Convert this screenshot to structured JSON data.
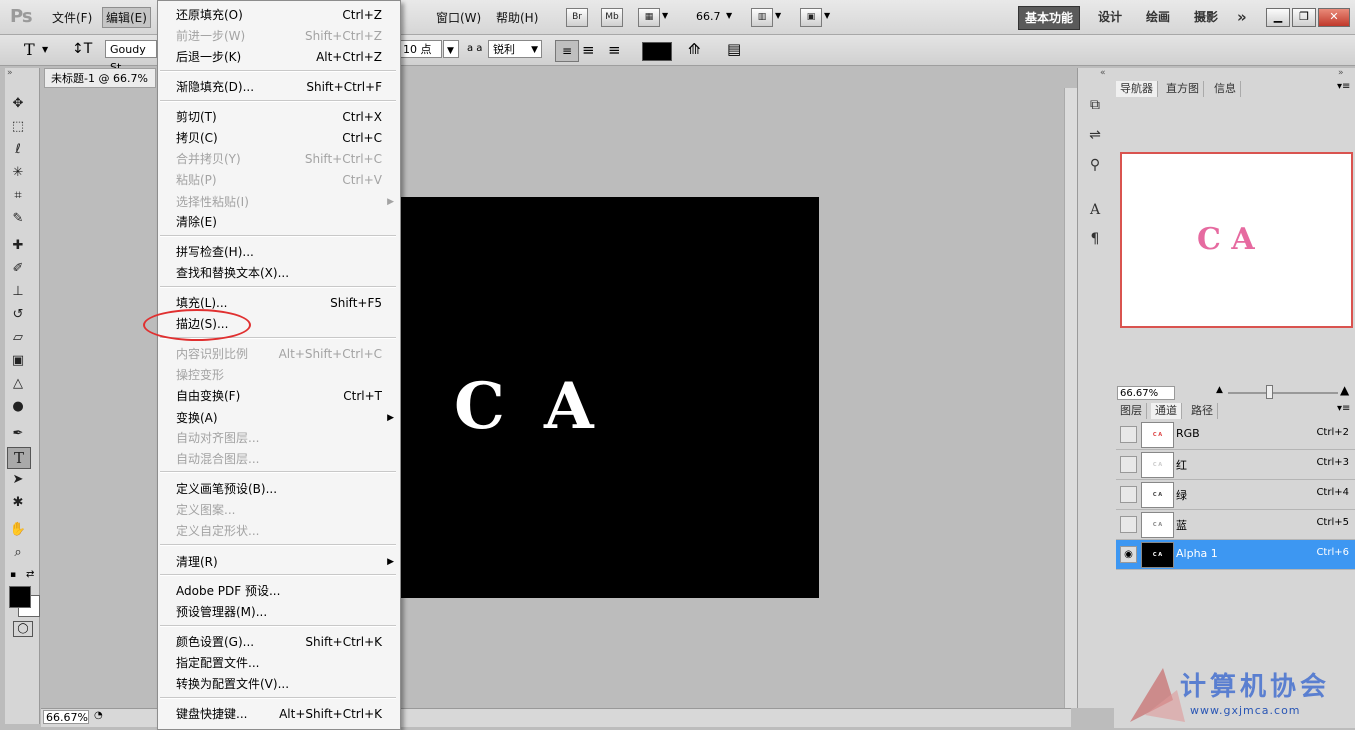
{
  "app": {
    "logo": "Ps"
  },
  "menubar": {
    "items": [
      "文件(F)",
      "编辑(E)",
      "窗口(W)",
      "帮助(H)"
    ],
    "br": "Br",
    "mb": "Mb",
    "zoom": "66.7",
    "workspaces": [
      "基本功能",
      "设计",
      "绘画",
      "摄影"
    ],
    "more": "»"
  },
  "options": {
    "tool_glyph": "T",
    "font_name": "Goudy St",
    "size": "10 点",
    "aa_label": "a a",
    "antialias": "锐利",
    "text_color": "#000000"
  },
  "document": {
    "tab_title": "未标题-1 @ 66.7%",
    "canvas_text": [
      "C",
      "A"
    ],
    "zoom": "66.67%"
  },
  "menu": {
    "items": [
      {
        "label": "还原填充(O)",
        "shortcut": "Ctrl+Z",
        "disabled": false
      },
      {
        "label": "前进一步(W)",
        "shortcut": "Shift+Ctrl+Z",
        "disabled": true
      },
      {
        "label": "后退一步(K)",
        "shortcut": "Alt+Ctrl+Z",
        "disabled": false
      },
      {
        "label": "渐隐填充(D)...",
        "shortcut": "Shift+Ctrl+F",
        "disabled": false
      },
      {
        "label": "剪切(T)",
        "shortcut": "Ctrl+X",
        "disabled": false
      },
      {
        "label": "拷贝(C)",
        "shortcut": "Ctrl+C",
        "disabled": false
      },
      {
        "label": "合并拷贝(Y)",
        "shortcut": "Shift+Ctrl+C",
        "disabled": true
      },
      {
        "label": "粘贴(P)",
        "shortcut": "Ctrl+V",
        "disabled": true
      },
      {
        "label": "选择性粘贴(I)",
        "shortcut": "",
        "disabled": true,
        "submenu": true
      },
      {
        "label": "清除(E)",
        "shortcut": "",
        "disabled": false
      },
      {
        "label": "拼写检查(H)...",
        "shortcut": "",
        "disabled": false
      },
      {
        "label": "查找和替换文本(X)...",
        "shortcut": "",
        "disabled": false
      },
      {
        "label": "填充(L)...",
        "shortcut": "Shift+F5",
        "disabled": false
      },
      {
        "label": "描边(S)...",
        "shortcut": "",
        "disabled": false
      },
      {
        "label": "内容识别比例",
        "shortcut": "Alt+Shift+Ctrl+C",
        "disabled": true
      },
      {
        "label": "操控变形",
        "shortcut": "",
        "disabled": true
      },
      {
        "label": "自由变换(F)",
        "shortcut": "Ctrl+T",
        "disabled": false
      },
      {
        "label": "变换(A)",
        "shortcut": "",
        "disabled": false,
        "submenu": true
      },
      {
        "label": "自动对齐图层...",
        "shortcut": "",
        "disabled": true
      },
      {
        "label": "自动混合图层...",
        "shortcut": "",
        "disabled": true
      },
      {
        "label": "定义画笔预设(B)...",
        "shortcut": "",
        "disabled": false
      },
      {
        "label": "定义图案...",
        "shortcut": "",
        "disabled": true
      },
      {
        "label": "定义自定形状...",
        "shortcut": "",
        "disabled": true
      },
      {
        "label": "清理(R)",
        "shortcut": "",
        "disabled": false,
        "submenu": true
      },
      {
        "label": "Adobe PDF 预设...",
        "shortcut": "",
        "disabled": false
      },
      {
        "label": "预设管理器(M)...",
        "shortcut": "",
        "disabled": false
      },
      {
        "label": "颜色设置(G)...",
        "shortcut": "Shift+Ctrl+K",
        "disabled": false
      },
      {
        "label": "指定配置文件...",
        "shortcut": "",
        "disabled": false
      },
      {
        "label": "转换为配置文件(V)...",
        "shortcut": "",
        "disabled": false
      },
      {
        "label": "键盘快捷键...",
        "shortcut": "Alt+Shift+Ctrl+K",
        "disabled": false
      }
    ]
  },
  "navigator": {
    "tabs": [
      "导航器",
      "直方图",
      "信息"
    ],
    "preview_text": "C A",
    "zoom": "66.67%"
  },
  "channels": {
    "tabs": [
      "图层",
      "通道",
      "路径"
    ],
    "rows": [
      {
        "name": "RGB",
        "shortcut": "Ctrl+2"
      },
      {
        "name": "红",
        "shortcut": "Ctrl+3"
      },
      {
        "name": "绿",
        "shortcut": "Ctrl+4"
      },
      {
        "name": "蓝",
        "shortcut": "Ctrl+5"
      },
      {
        "name": "Alpha 1",
        "shortcut": "Ctrl+6"
      }
    ]
  },
  "watermark": {
    "text": "计算机协会",
    "url": "www.gxjmca.com"
  }
}
